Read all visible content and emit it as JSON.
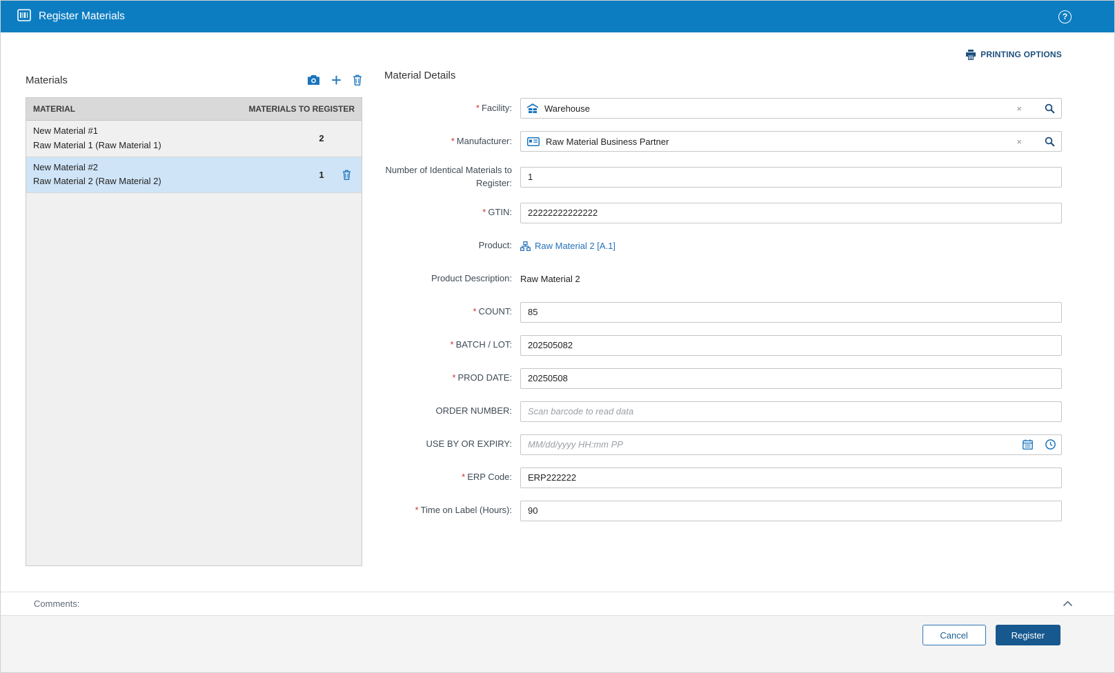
{
  "titlebar": {
    "title": "Register Materials",
    "help_glyph": "?"
  },
  "toolbar": {
    "printing_options_label": "PRINTING OPTIONS"
  },
  "materials": {
    "heading": "Materials",
    "actions": {
      "add_glyph": "+"
    },
    "table": {
      "col_material": "MATERIAL",
      "col_to_register": "MATERIALS TO REGISTER",
      "rows": [
        {
          "name": "New Material #1",
          "description": "Raw Material 1 (Raw Material 1)",
          "count": "2",
          "selected": false
        },
        {
          "name": "New Material #2",
          "description": "Raw Material 2 (Raw Material 2)",
          "count": "1",
          "selected": true
        }
      ]
    }
  },
  "details": {
    "heading": "Material Details",
    "required_marker": "*",
    "clear_glyph": "×",
    "facility": {
      "label": "Facility:",
      "value": "Warehouse",
      "required": true
    },
    "manufacturer": {
      "label": "Manufacturer:",
      "value": "Raw Material Business Partner",
      "required": true
    },
    "identical_count": {
      "label": "Number of Identical Materials to Register:",
      "value": "1",
      "required": false
    },
    "gtin": {
      "label": "GTIN:",
      "value": "22222222222222",
      "required": true
    },
    "product": {
      "label": "Product:",
      "link_text": "Raw Material 2 [A.1]"
    },
    "product_description": {
      "label": "Product Description:",
      "value": "Raw Material 2"
    },
    "count": {
      "label": "COUNT:",
      "value": "85",
      "required": true
    },
    "batch_lot": {
      "label": "BATCH / LOT:",
      "value": "202505082",
      "required": true
    },
    "prod_date": {
      "label": "PROD DATE:",
      "value": "20250508",
      "required": true
    },
    "order_number": {
      "label": "ORDER NUMBER:",
      "placeholder": "Scan barcode to read data"
    },
    "use_by": {
      "label": "USE BY OR EXPIRY:",
      "placeholder": "MM/dd/yyyy HH:mm PP"
    },
    "erp_code": {
      "label": "ERP Code:",
      "value": "ERP222222",
      "required": true
    },
    "time_on_label": {
      "label": "Time on Label (Hours):",
      "value": "90",
      "required": true
    }
  },
  "comments": {
    "label": "Comments:"
  },
  "footer": {
    "cancel_label": "Cancel",
    "register_label": "Register"
  },
  "colors": {
    "titlebar_blue": "#0d7dc1",
    "icon_blue": "#1a74bc",
    "dark_navy": "#1d4f7c",
    "link_blue": "#2272b9",
    "required_red": "#cf2f2f",
    "selected_row": "#cfe4f7",
    "register_button": "#17588e"
  }
}
